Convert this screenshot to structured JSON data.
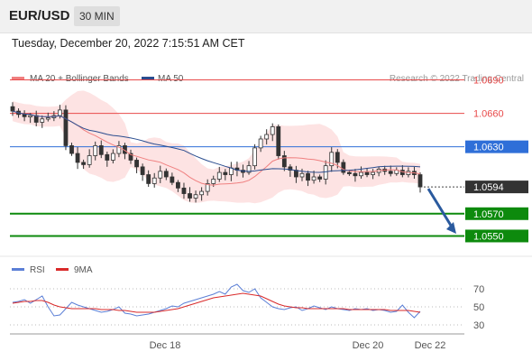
{
  "header": {
    "pair": "EUR/USD",
    "timeframe": "30 MIN",
    "timestamp": "Tuesday, December 20, 2022 7:15:51 AM CET"
  },
  "legend": {
    "ma20": "MA 20 + Bollinger Bands",
    "ma50": "MA 50",
    "credit": "Research © 2022 Trading Central",
    "colors": {
      "ma20": "#f08080",
      "ma50": "#2a4d8f"
    }
  },
  "chart_data": [
    {
      "type": "line",
      "ylim": [
        1.0535,
        1.0705
      ],
      "levels": [
        {
          "value": 1.069,
          "label": "1.0690",
          "kind": "resistance",
          "color": "#e84a4a"
        },
        {
          "value": 1.066,
          "label": "1.0660",
          "kind": "resistance",
          "color": "#e84a4a"
        },
        {
          "value": 1.063,
          "label": "1.0630",
          "kind": "pivot",
          "color": "#2f6fd8"
        },
        {
          "value": 1.0594,
          "label": "1.0594",
          "kind": "last",
          "color": "#333333"
        },
        {
          "value": 1.057,
          "label": "1.0570",
          "kind": "support",
          "color": "#0d8a0d"
        },
        {
          "value": 1.055,
          "label": "1.0550",
          "kind": "support",
          "color": "#0d8a0d"
        }
      ],
      "x_ticks": [
        "Dec 18",
        "Dec 20",
        "Dec 22"
      ],
      "price_close": [
        1.0662,
        1.0659,
        1.0657,
        1.0658,
        1.0652,
        1.0655,
        1.0656,
        1.0658,
        1.0663,
        1.0631,
        1.0624,
        1.0616,
        1.0614,
        1.0622,
        1.0631,
        1.0623,
        1.0618,
        1.0624,
        1.0631,
        1.0624,
        1.0618,
        1.0612,
        1.0605,
        1.0597,
        1.0602,
        1.0608,
        1.0603,
        1.0598,
        1.0593,
        1.0588,
        1.0584,
        1.0587,
        1.059,
        1.0597,
        1.0601,
        1.0607,
        1.0605,
        1.0611,
        1.0609,
        1.0607,
        1.0613,
        1.0629,
        1.0637,
        1.0641,
        1.0648,
        1.0622,
        1.0612,
        1.0609,
        1.0603,
        1.0606,
        1.06,
        1.0603,
        1.0601,
        1.0613,
        1.0625,
        1.0616,
        1.0607,
        1.0606,
        1.0604,
        1.0607,
        1.0605,
        1.0607,
        1.061,
        1.0608,
        1.0606,
        1.0609,
        1.0605,
        1.0608,
        1.0605,
        1.0594
      ]
    },
    {
      "type": "line",
      "series": [
        {
          "name": "RSI",
          "color": "#5b7fd6",
          "values": [
            55,
            56,
            58,
            54,
            58,
            62,
            50,
            40,
            41,
            48,
            55,
            52,
            50,
            48,
            46,
            44,
            45,
            47,
            50,
            43,
            42,
            40,
            41,
            42,
            44,
            46,
            48,
            51,
            50,
            54,
            56,
            58,
            60,
            62,
            64,
            67,
            64,
            72,
            75,
            68,
            66,
            70,
            60,
            55,
            50,
            48,
            47,
            49,
            50,
            46,
            48,
            51,
            49,
            47,
            50,
            48,
            47,
            46,
            48,
            47,
            48,
            46,
            47,
            46,
            44,
            45,
            52,
            44,
            38,
            45
          ]
        },
        {
          "name": "9MA",
          "color": "#d92a2a",
          "values": [
            54,
            55,
            56,
            56,
            57,
            57,
            55,
            52,
            50,
            49,
            48,
            48,
            48,
            48,
            48,
            47,
            47,
            47,
            46,
            46,
            45,
            44,
            44,
            44,
            44,
            45,
            46,
            47,
            48,
            50,
            52,
            54,
            56,
            58,
            60,
            61,
            62,
            63,
            64,
            65,
            64,
            63,
            62,
            59,
            56,
            53,
            51,
            50,
            49,
            49,
            48,
            48,
            48,
            48,
            48,
            48,
            48,
            47,
            47,
            47,
            47,
            47,
            47,
            47,
            46,
            46,
            46,
            46,
            45,
            44
          ]
        }
      ],
      "ylim": [
        20,
        80
      ],
      "ticks": [
        "70",
        "50",
        "30"
      ]
    }
  ]
}
